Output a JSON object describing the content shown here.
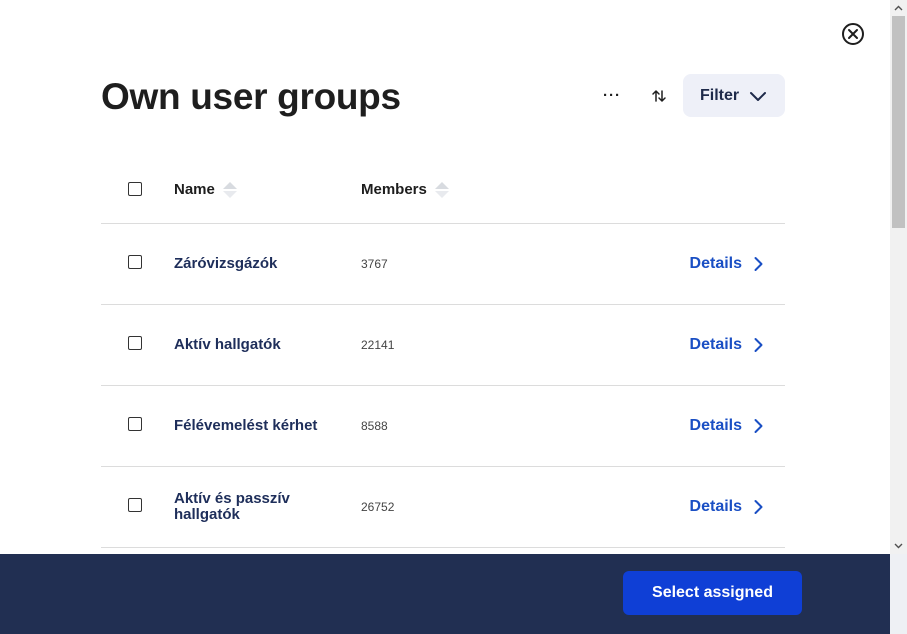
{
  "modal": {
    "title": "Own user groups",
    "more_label": "···",
    "filter_label": "Filter"
  },
  "table": {
    "columns": {
      "name": "Name",
      "members": "Members"
    },
    "rows": [
      {
        "name": "Záróvizsgázók",
        "members": "3767",
        "details": "Details"
      },
      {
        "name": "Aktív hallgatók",
        "members": "22141",
        "details": "Details"
      },
      {
        "name": "Félévemelést kérhet",
        "members": "8588",
        "details": "Details"
      },
      {
        "name": "Aktív és passzív hallgatók",
        "members": "26752",
        "details": "Details"
      }
    ]
  },
  "footer": {
    "select_label": "Select assigned"
  },
  "colors": {
    "accent": "#0f3fd6",
    "footer_bg": "#212f52",
    "link": "#1a4fc4",
    "name_text": "#1e2e5a"
  },
  "icons": {
    "close": "close-circle-icon",
    "sort": "sort-arrows-icon",
    "filter_chevron": "chevron-down-icon",
    "details_chevron": "chevron-right-icon"
  }
}
